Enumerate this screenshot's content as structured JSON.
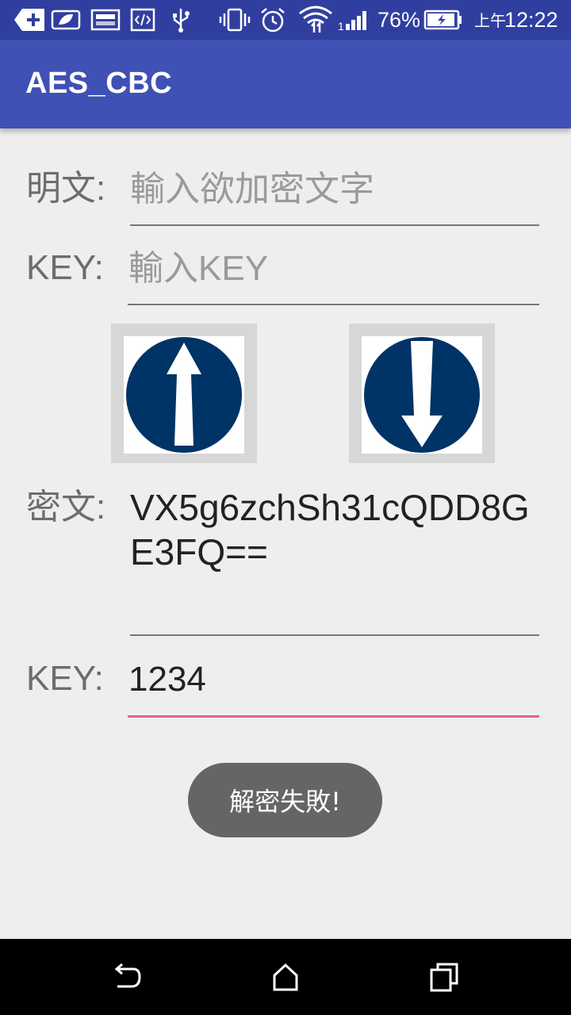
{
  "status_bar": {
    "battery_percent": "76%",
    "time_prefix": "上午",
    "time": "12:22"
  },
  "app_bar": {
    "title": "AES_CBC"
  },
  "plaintext": {
    "label": "明文:",
    "value": "",
    "placeholder": "輸入欲加密文字"
  },
  "key1": {
    "label": "KEY:",
    "value": "",
    "placeholder": "輸入KEY"
  },
  "ciphertext": {
    "label": "密文:",
    "value": "VX5g6zchSh31cQDD8GE3FQ=="
  },
  "key2": {
    "label": "KEY:",
    "value": "1234",
    "placeholder": ""
  },
  "toast": {
    "message": "解密失敗!"
  },
  "colors": {
    "status_bar": "#303f9f",
    "app_bar": "#3f51b5",
    "accent": "#e0668a",
    "arrow_circle": "#003366"
  }
}
